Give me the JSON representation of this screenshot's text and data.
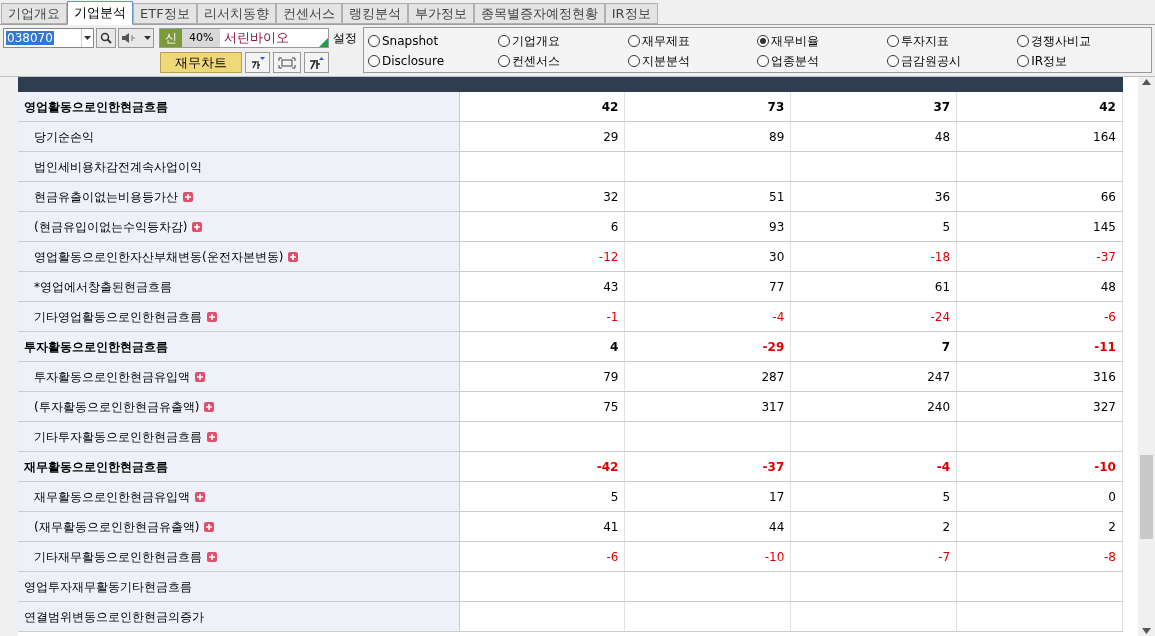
{
  "tabs": [
    {
      "label": "기업개요",
      "selected": false
    },
    {
      "label": "기업분석",
      "selected": true
    },
    {
      "label": "ETF정보",
      "selected": false
    },
    {
      "label": "리서치동향",
      "selected": false
    },
    {
      "label": "컨센서스",
      "selected": false
    },
    {
      "label": "랭킹분석",
      "selected": false
    },
    {
      "label": "부가정보",
      "selected": false
    },
    {
      "label": "종목별증자예정현황",
      "selected": false
    },
    {
      "label": "IR정보",
      "selected": false
    }
  ],
  "toolbar": {
    "code": "038070",
    "badge": "신",
    "ratio": "40%",
    "stock_name": "서린바이오",
    "settings_label": "설정",
    "chart_button": "재무차트"
  },
  "views": [
    {
      "label": "Snapshot",
      "selected": false
    },
    {
      "label": "기업개요",
      "selected": false
    },
    {
      "label": "재무제표",
      "selected": false
    },
    {
      "label": "재무비율",
      "selected": true
    },
    {
      "label": "투자지표",
      "selected": false
    },
    {
      "label": "경쟁사비교",
      "selected": false
    },
    {
      "label": "Disclosure",
      "selected": false
    },
    {
      "label": "컨센서스",
      "selected": false
    },
    {
      "label": "지분분석",
      "selected": false
    },
    {
      "label": "업종분석",
      "selected": false
    },
    {
      "label": "금감원공시",
      "selected": false
    },
    {
      "label": "IR정보",
      "selected": false
    }
  ],
  "table": {
    "rows": [
      {
        "label": "영업활동으로인한현금흐름",
        "bold": true,
        "values": [
          "42",
          "73",
          "37",
          "42"
        ],
        "children": [
          {
            "label": "당기순손익",
            "values": [
              "29",
              "89",
              "48",
              "164"
            ]
          },
          {
            "label": "법인세비용차감전계속사업이익"
          },
          {
            "label": "현금유출이없는비용등가산",
            "expandable": true,
            "values": [
              "32",
              "51",
              "36",
              "66"
            ]
          },
          {
            "label": "(현금유입이없는수익등차감)",
            "expandable": true,
            "values": [
              "6",
              "93",
              "5",
              "145"
            ]
          },
          {
            "label": "영업활동으로인한자산부채변동(운전자본변동)",
            "expandable": true,
            "values": [
              "-12",
              "30",
              "-18",
              "-37"
            ]
          },
          {
            "label": "*영업에서창출된현금흐름",
            "values": [
              "43",
              "77",
              "61",
              "48"
            ]
          },
          {
            "label": "기타영업활동으로인한현금흐름",
            "expandable": true,
            "values": [
              "-1",
              "-4",
              "-24",
              "-6"
            ]
          }
        ]
      },
      {
        "label": "투자활동으로인한현금흐름",
        "bold": true,
        "values": [
          "4",
          "-29",
          "7",
          "-11"
        ],
        "children": [
          {
            "label": "투자활동으로인한현금유입액",
            "expandable": true,
            "values": [
              "79",
              "287",
              "247",
              "316"
            ]
          },
          {
            "label": "(투자활동으로인한현금유출액)",
            "expandable": true,
            "values": [
              "75",
              "317",
              "240",
              "327"
            ]
          },
          {
            "label": "기타투자활동으로인한현금흐름",
            "expandable": true
          }
        ]
      },
      {
        "label": "재무활동으로인한현금흐름",
        "bold": true,
        "values": [
          "-42",
          "-37",
          "-4",
          "-10"
        ],
        "children": [
          {
            "label": "재무활동으로인한현금유입액",
            "expandable": true,
            "values": [
              "5",
              "17",
              "5",
              "0"
            ]
          },
          {
            "label": "(재무활동으로인한현금유출액)",
            "expandable": true,
            "values": [
              "41",
              "44",
              "2",
              "2"
            ]
          },
          {
            "label": "기타재무활동으로인한현금흐름",
            "expandable": true,
            "values": [
              "-6",
              "-10",
              "-7",
              "-8"
            ]
          }
        ]
      },
      {
        "label": "영업투자재무활동기타현금흐름"
      },
      {
        "label": "연결범위변동으로인한현금의증가"
      }
    ]
  }
}
